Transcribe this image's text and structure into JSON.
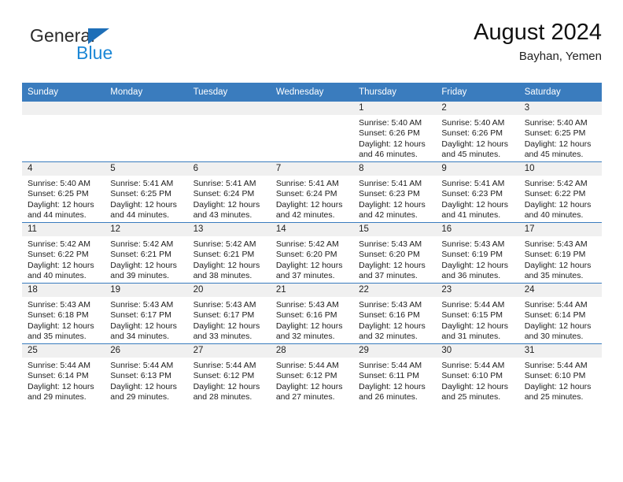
{
  "brand": {
    "name_top": "General",
    "name_bottom": "Blue",
    "color_primary": "#1b87d6",
    "color_triangle": "#1e6fb8"
  },
  "header": {
    "title": "August 2024",
    "subtitle": "Bayhan, Yemen"
  },
  "theme": {
    "header_row_bg": "#3a7cbe",
    "daynum_band_bg": "#f0f0f0",
    "cell_border": "#3a7cbe",
    "text": "#1c1c1c"
  },
  "weekday_headers": [
    "Sunday",
    "Monday",
    "Tuesday",
    "Wednesday",
    "Thursday",
    "Friday",
    "Saturday"
  ],
  "labels": {
    "sunrise_prefix": "Sunrise:",
    "sunset_prefix": "Sunset:",
    "daylight_prefix": "Daylight:"
  },
  "weeks": [
    [
      {
        "empty": true
      },
      {
        "empty": true
      },
      {
        "empty": true
      },
      {
        "empty": true
      },
      {
        "day": "1",
        "sunrise": "Sunrise: 5:40 AM",
        "sunset": "Sunset: 6:26 PM",
        "daylight": "Daylight: 12 hours and 46 minutes."
      },
      {
        "day": "2",
        "sunrise": "Sunrise: 5:40 AM",
        "sunset": "Sunset: 6:26 PM",
        "daylight": "Daylight: 12 hours and 45 minutes."
      },
      {
        "day": "3",
        "sunrise": "Sunrise: 5:40 AM",
        "sunset": "Sunset: 6:25 PM",
        "daylight": "Daylight: 12 hours and 45 minutes."
      }
    ],
    [
      {
        "day": "4",
        "sunrise": "Sunrise: 5:40 AM",
        "sunset": "Sunset: 6:25 PM",
        "daylight": "Daylight: 12 hours and 44 minutes."
      },
      {
        "day": "5",
        "sunrise": "Sunrise: 5:41 AM",
        "sunset": "Sunset: 6:25 PM",
        "daylight": "Daylight: 12 hours and 44 minutes."
      },
      {
        "day": "6",
        "sunrise": "Sunrise: 5:41 AM",
        "sunset": "Sunset: 6:24 PM",
        "daylight": "Daylight: 12 hours and 43 minutes."
      },
      {
        "day": "7",
        "sunrise": "Sunrise: 5:41 AM",
        "sunset": "Sunset: 6:24 PM",
        "daylight": "Daylight: 12 hours and 42 minutes."
      },
      {
        "day": "8",
        "sunrise": "Sunrise: 5:41 AM",
        "sunset": "Sunset: 6:23 PM",
        "daylight": "Daylight: 12 hours and 42 minutes."
      },
      {
        "day": "9",
        "sunrise": "Sunrise: 5:41 AM",
        "sunset": "Sunset: 6:23 PM",
        "daylight": "Daylight: 12 hours and 41 minutes."
      },
      {
        "day": "10",
        "sunrise": "Sunrise: 5:42 AM",
        "sunset": "Sunset: 6:22 PM",
        "daylight": "Daylight: 12 hours and 40 minutes."
      }
    ],
    [
      {
        "day": "11",
        "sunrise": "Sunrise: 5:42 AM",
        "sunset": "Sunset: 6:22 PM",
        "daylight": "Daylight: 12 hours and 40 minutes."
      },
      {
        "day": "12",
        "sunrise": "Sunrise: 5:42 AM",
        "sunset": "Sunset: 6:21 PM",
        "daylight": "Daylight: 12 hours and 39 minutes."
      },
      {
        "day": "13",
        "sunrise": "Sunrise: 5:42 AM",
        "sunset": "Sunset: 6:21 PM",
        "daylight": "Daylight: 12 hours and 38 minutes."
      },
      {
        "day": "14",
        "sunrise": "Sunrise: 5:42 AM",
        "sunset": "Sunset: 6:20 PM",
        "daylight": "Daylight: 12 hours and 37 minutes."
      },
      {
        "day": "15",
        "sunrise": "Sunrise: 5:43 AM",
        "sunset": "Sunset: 6:20 PM",
        "daylight": "Daylight: 12 hours and 37 minutes."
      },
      {
        "day": "16",
        "sunrise": "Sunrise: 5:43 AM",
        "sunset": "Sunset: 6:19 PM",
        "daylight": "Daylight: 12 hours and 36 minutes."
      },
      {
        "day": "17",
        "sunrise": "Sunrise: 5:43 AM",
        "sunset": "Sunset: 6:19 PM",
        "daylight": "Daylight: 12 hours and 35 minutes."
      }
    ],
    [
      {
        "day": "18",
        "sunrise": "Sunrise: 5:43 AM",
        "sunset": "Sunset: 6:18 PM",
        "daylight": "Daylight: 12 hours and 35 minutes."
      },
      {
        "day": "19",
        "sunrise": "Sunrise: 5:43 AM",
        "sunset": "Sunset: 6:17 PM",
        "daylight": "Daylight: 12 hours and 34 minutes."
      },
      {
        "day": "20",
        "sunrise": "Sunrise: 5:43 AM",
        "sunset": "Sunset: 6:17 PM",
        "daylight": "Daylight: 12 hours and 33 minutes."
      },
      {
        "day": "21",
        "sunrise": "Sunrise: 5:43 AM",
        "sunset": "Sunset: 6:16 PM",
        "daylight": "Daylight: 12 hours and 32 minutes."
      },
      {
        "day": "22",
        "sunrise": "Sunrise: 5:43 AM",
        "sunset": "Sunset: 6:16 PM",
        "daylight": "Daylight: 12 hours and 32 minutes."
      },
      {
        "day": "23",
        "sunrise": "Sunrise: 5:44 AM",
        "sunset": "Sunset: 6:15 PM",
        "daylight": "Daylight: 12 hours and 31 minutes."
      },
      {
        "day": "24",
        "sunrise": "Sunrise: 5:44 AM",
        "sunset": "Sunset: 6:14 PM",
        "daylight": "Daylight: 12 hours and 30 minutes."
      }
    ],
    [
      {
        "day": "25",
        "sunrise": "Sunrise: 5:44 AM",
        "sunset": "Sunset: 6:14 PM",
        "daylight": "Daylight: 12 hours and 29 minutes."
      },
      {
        "day": "26",
        "sunrise": "Sunrise: 5:44 AM",
        "sunset": "Sunset: 6:13 PM",
        "daylight": "Daylight: 12 hours and 29 minutes."
      },
      {
        "day": "27",
        "sunrise": "Sunrise: 5:44 AM",
        "sunset": "Sunset: 6:12 PM",
        "daylight": "Daylight: 12 hours and 28 minutes."
      },
      {
        "day": "28",
        "sunrise": "Sunrise: 5:44 AM",
        "sunset": "Sunset: 6:12 PM",
        "daylight": "Daylight: 12 hours and 27 minutes."
      },
      {
        "day": "29",
        "sunrise": "Sunrise: 5:44 AM",
        "sunset": "Sunset: 6:11 PM",
        "daylight": "Daylight: 12 hours and 26 minutes."
      },
      {
        "day": "30",
        "sunrise": "Sunrise: 5:44 AM",
        "sunset": "Sunset: 6:10 PM",
        "daylight": "Daylight: 12 hours and 25 minutes."
      },
      {
        "day": "31",
        "sunrise": "Sunrise: 5:44 AM",
        "sunset": "Sunset: 6:10 PM",
        "daylight": "Daylight: 12 hours and 25 minutes."
      }
    ]
  ]
}
